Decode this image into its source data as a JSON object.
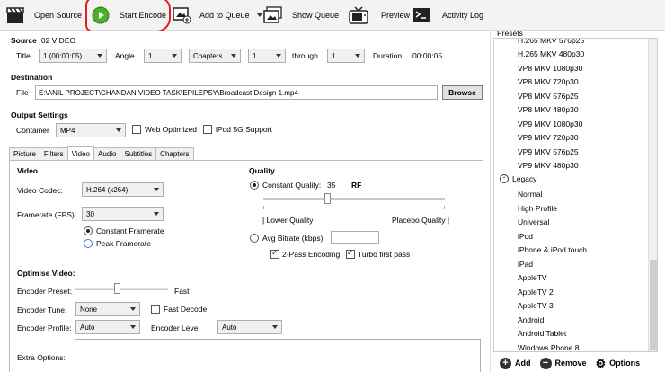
{
  "toolbar": {
    "open_source": "Open Source",
    "start_encode": "Start Encode",
    "add_to_queue": "Add to Queue",
    "show_queue": "Show Queue",
    "preview": "Preview",
    "activity_log": "Activity Log"
  },
  "source": {
    "label": "Source",
    "value": "02 VIDEO",
    "title_label": "Title",
    "title_value": "1 (00:00:05)",
    "angle_label": "Angle",
    "angle_value": "1",
    "range_type": "Chapters",
    "range_start": "1",
    "through_label": "through",
    "range_end": "1",
    "duration_label": "Duration",
    "duration_value": "00:00:05"
  },
  "destination": {
    "heading": "Destination",
    "file_label": "File",
    "file_value": "E:\\ANIL PROJECT\\CHANDAN VIDEO TASK\\EPILEPSY\\Broadcast Design 1.mp4",
    "browse_label": "Browse"
  },
  "output": {
    "heading": "Output Settings",
    "container_label": "Container",
    "container_value": "MP4",
    "web_optimized": "Web Optimized",
    "ipod_support": "iPod 5G Support"
  },
  "tabs": [
    "Picture",
    "Filters",
    "Video",
    "Audio",
    "Subtitles",
    "Chapters"
  ],
  "active_tab": "Video",
  "video": {
    "heading": "Video",
    "codec_label": "Video Codec:",
    "codec_value": "H.264 (x264)",
    "framerate_label": "Framerate (FPS):",
    "framerate_value": "30",
    "constant_framerate": "Constant Framerate",
    "peak_framerate": "Peak Framerate"
  },
  "quality": {
    "heading": "Quality",
    "constant_quality": "Constant Quality:",
    "cq_value": "35",
    "cq_unit": "RF",
    "cq_slider_fraction": 0.35,
    "lower_quality": "| Lower Quality",
    "placebo_quality": "Placebo Quality |",
    "avg_bitrate": "Avg Bitrate (kbps):",
    "two_pass": "2-Pass Encoding",
    "turbo": "Turbo first pass"
  },
  "optimise": {
    "heading": "Optimise Video:",
    "preset_label": "Encoder Preset:",
    "preset_value": "Fast",
    "preset_slider_fraction": 0.45,
    "tune_label": "Encoder Tune:",
    "tune_value": "None",
    "fast_decode": "Fast Decode",
    "profile_label": "Encoder Profile:",
    "profile_value": "Auto",
    "level_label": "Encoder Level",
    "level_value": "Auto",
    "extra_options": "Extra Options:"
  },
  "presets": {
    "title": "Presets",
    "items_top": [
      "H.265 MKV 576p25",
      "H.265 MKV 480p30",
      "VP8 MKV 1080p30",
      "VP8 MKV 720p30",
      "VP8 MKV 576p25",
      "VP8 MKV 480p30",
      "VP9 MKV 1080p30",
      "VP9 MKV 720p30",
      "VP9 MKV 576p25",
      "VP9 MKV 480p30"
    ],
    "group": "Legacy",
    "items_legacy": [
      "Normal",
      "High Profile",
      "Universal",
      "iPod",
      "iPhone & iPod touch",
      "iPad",
      "AppleTV",
      "AppleTV 2",
      "AppleTV 3",
      "Android",
      "Android Tablet",
      "Windows Phone 8"
    ],
    "add": "Add",
    "remove": "Remove",
    "options": "Options"
  },
  "colors": {
    "play_green": "#4caf2a",
    "highlight_red": "#e0201c"
  }
}
